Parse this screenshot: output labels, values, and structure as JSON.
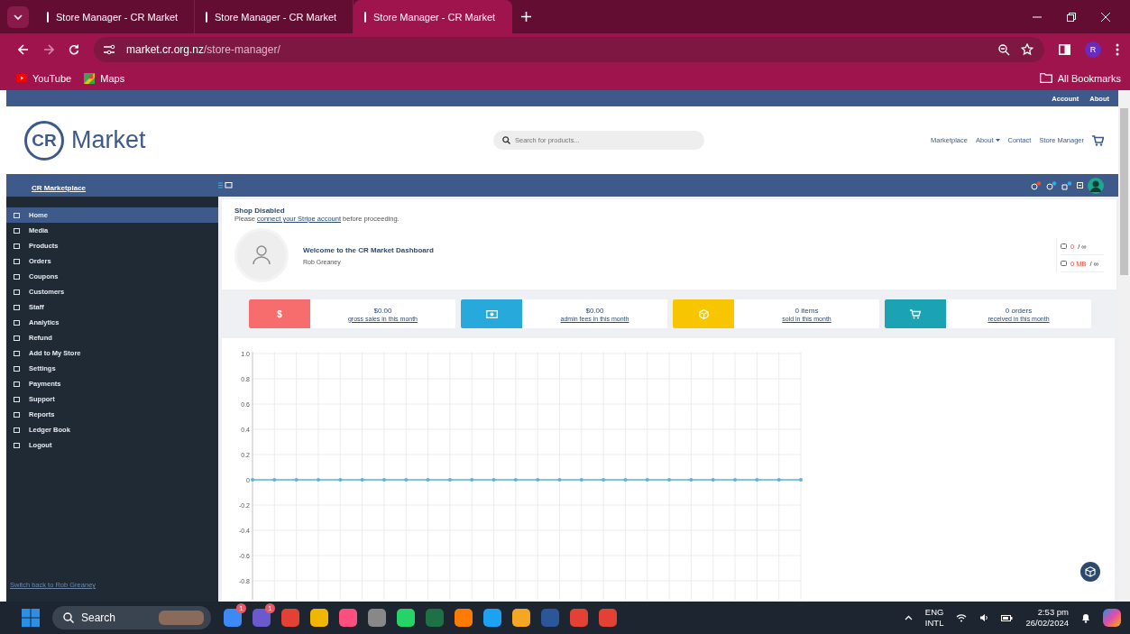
{
  "browser": {
    "tabs": [
      {
        "title": "Store Manager - CR Market",
        "selected": false
      },
      {
        "title": "Store Manager - CR Market",
        "selected": false
      },
      {
        "title": "Store Manager - CR Market",
        "selected": true
      }
    ],
    "url_host": "market.cr.org.nz",
    "url_path": "/store-manager/",
    "profile_initial": "R",
    "bookmarks": [
      "YouTube",
      "Maps"
    ],
    "all_bookmarks": "All Bookmarks"
  },
  "site": {
    "top_links": [
      "Account",
      "About"
    ],
    "logo_badge": "CR",
    "logo_text": "Market",
    "search_placeholder": "Search for products...",
    "nav": [
      {
        "label": "Marketplace",
        "dropdown": false
      },
      {
        "label": "About",
        "dropdown": true
      },
      {
        "label": "Contact",
        "dropdown": false
      },
      {
        "label": "Store Manager",
        "dropdown": false
      }
    ]
  },
  "manager": {
    "store_link": "CR Marketplace",
    "sidebar": [
      {
        "label": "Home",
        "selected": true
      },
      {
        "label": "Media",
        "selected": false
      },
      {
        "label": "Products",
        "selected": false
      },
      {
        "label": "Orders",
        "selected": false
      },
      {
        "label": "Coupons",
        "selected": false
      },
      {
        "label": "Customers",
        "selected": false
      },
      {
        "label": "Staff",
        "selected": false
      },
      {
        "label": "Analytics",
        "selected": false
      },
      {
        "label": "Refund",
        "selected": false
      },
      {
        "label": "Add to My Store",
        "selected": false
      },
      {
        "label": "Settings",
        "selected": false
      },
      {
        "label": "Payments",
        "selected": false
      },
      {
        "label": "Support",
        "selected": false
      },
      {
        "label": "Reports",
        "selected": false
      },
      {
        "label": "Ledger Book",
        "selected": false
      },
      {
        "label": "Logout",
        "selected": false
      }
    ],
    "switch_back": "Switch back to Rob Greaney",
    "notice_title": "Shop Disabled",
    "notice_before": "Please ",
    "notice_link": "connect your Stripe account",
    "notice_after": " before proceeding.",
    "welcome": "Welcome to the CR Market Dashboard",
    "user": "Rob Greaney",
    "limits": [
      {
        "value": "0",
        "limit": "/ ∞"
      },
      {
        "value": "0 MB",
        "limit": "/ ∞"
      }
    ],
    "stats": [
      {
        "color": "#f76d6d",
        "icon_text": "$",
        "value": "$0.00",
        "caption": "gross sales in this month"
      },
      {
        "color": "#27a9dc",
        "value": "$0.00",
        "caption": "admin fees in this month"
      },
      {
        "color": "#f7c600",
        "value": "0 items",
        "caption": "sold in this month"
      },
      {
        "color": "#1ba2b3",
        "value": "0 orders",
        "caption": "received in this month"
      }
    ],
    "chart_data": {
      "type": "line",
      "grid": true,
      "ylim": [
        -0.95,
        1.0
      ],
      "yticks": [
        {
          "value": 1,
          "label": "1.0"
        },
        0.8,
        0.6,
        0.4,
        0.2,
        0,
        -0.2,
        -0.4,
        -0.6,
        -0.8
      ],
      "series": [
        {
          "color": "#5ab4d6",
          "values": [
            0,
            0,
            0,
            0,
            0,
            0,
            0,
            0,
            0,
            0,
            0,
            0,
            0,
            0,
            0,
            0,
            0,
            0,
            0,
            0,
            0,
            0,
            0,
            0,
            0,
            0
          ]
        }
      ]
    }
  },
  "taskbar": {
    "search": "Search",
    "badges": [
      "1",
      "1"
    ],
    "lang": "ENG",
    "layout": "INTL",
    "time": "2:53 pm",
    "date": "26/02/2024"
  }
}
